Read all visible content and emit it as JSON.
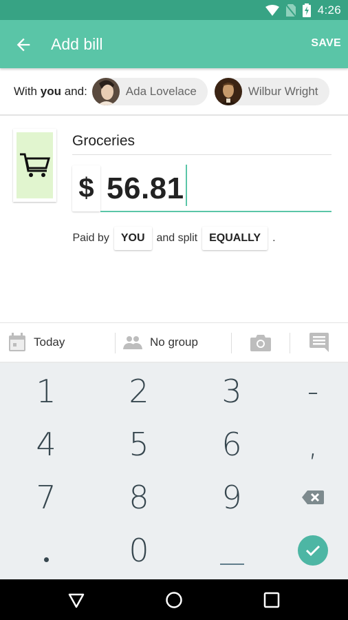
{
  "status_bar": {
    "time": "4:26",
    "icons": [
      "wifi-icon",
      "no-sim-icon",
      "battery-charging-icon"
    ]
  },
  "app_bar": {
    "title": "Add bill",
    "save_label": "SAVE",
    "back_icon": "arrow-back-icon"
  },
  "with_row": {
    "prefix": "With",
    "you": "you",
    "suffix": "and:",
    "people": [
      {
        "name": "Ada Lovelace"
      },
      {
        "name": "Wilbur Wright"
      }
    ]
  },
  "expense": {
    "category_icon": "shopping-cart-icon",
    "description": "Groceries",
    "currency_symbol": "$",
    "amount": "56.81"
  },
  "split": {
    "paid_by_label": "Paid by",
    "payer": "YOU",
    "and_split_label": "and split",
    "split_method": "EQUALLY",
    "end": "."
  },
  "toolbar": {
    "date_label": "Today",
    "group_label": "No group",
    "icons": [
      "calendar-icon",
      "group-icon",
      "camera-icon",
      "comment-icon"
    ]
  },
  "keypad": {
    "keys": [
      "1",
      "2",
      "3",
      "-",
      "4",
      "5",
      "6",
      ",",
      "7",
      "8",
      "9",
      "backspace",
      ".",
      "0",
      "space",
      "done"
    ]
  },
  "colors": {
    "status_bar": "#37a384",
    "primary": "#5ac5a7",
    "done_button": "#4db6a4",
    "category_bg": "#e1f5cf",
    "keypad_bg": "#eceff1"
  }
}
